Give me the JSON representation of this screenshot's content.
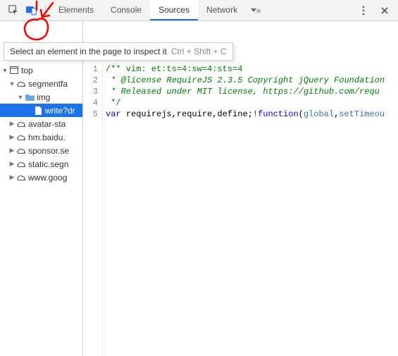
{
  "toolbar": {
    "tabs": [
      "Elements",
      "Console",
      "Sources",
      "Network"
    ],
    "selected_tab_index": 2
  },
  "tooltip": {
    "text": "Select an element in the page to inspect it",
    "shortcut": "Ctrl + Shift + C"
  },
  "file_tree": {
    "root": "top",
    "items": [
      {
        "label": "segmentfa",
        "icon": "cloud",
        "expanded": true,
        "depth": 1
      },
      {
        "label": "img",
        "icon": "folder",
        "expanded": true,
        "depth": 2
      },
      {
        "label": "write?dr",
        "icon": "file",
        "selected": true,
        "depth": 3
      },
      {
        "label": "avatar-sta",
        "icon": "cloud",
        "expanded": false,
        "depth": 1
      },
      {
        "label": "hm.baidu.",
        "icon": "cloud",
        "expanded": false,
        "depth": 1
      },
      {
        "label": "sponsor.se",
        "icon": "cloud",
        "expanded": false,
        "depth": 1
      },
      {
        "label": "static.segn",
        "icon": "cloud",
        "expanded": false,
        "depth": 1
      },
      {
        "label": "www.goog",
        "icon": "cloud",
        "expanded": false,
        "depth": 1
      }
    ]
  },
  "source": {
    "lines": [
      {
        "n": 1,
        "segments": [
          {
            "cls": "c-comment",
            "t": "/** vim: et:ts=4:sw=4:sts=4"
          }
        ]
      },
      {
        "n": 2,
        "segments": [
          {
            "cls": "c-comment c-italic",
            "t": " * @license RequireJS 2.3.5 Copyright jQuery Foundation"
          }
        ]
      },
      {
        "n": 3,
        "segments": [
          {
            "cls": "c-comment c-italic",
            "t": " * Released under MIT license, https://github.com/requ"
          }
        ]
      },
      {
        "n": 4,
        "segments": [
          {
            "cls": "c-comment",
            "t": " */"
          }
        ]
      },
      {
        "n": 5,
        "segments": [
          {
            "cls": "c-kw",
            "t": "var "
          },
          {
            "cls": "c-punc",
            "t": "requirejs,require,define;"
          },
          {
            "cls": "c-op",
            "t": "!"
          },
          {
            "cls": "c-kw",
            "t": "function"
          },
          {
            "cls": "c-punc",
            "t": "("
          },
          {
            "cls": "c-arg",
            "t": "global"
          },
          {
            "cls": "c-punc",
            "t": ","
          },
          {
            "cls": "c-arg",
            "t": "setTimeou"
          }
        ]
      }
    ]
  }
}
